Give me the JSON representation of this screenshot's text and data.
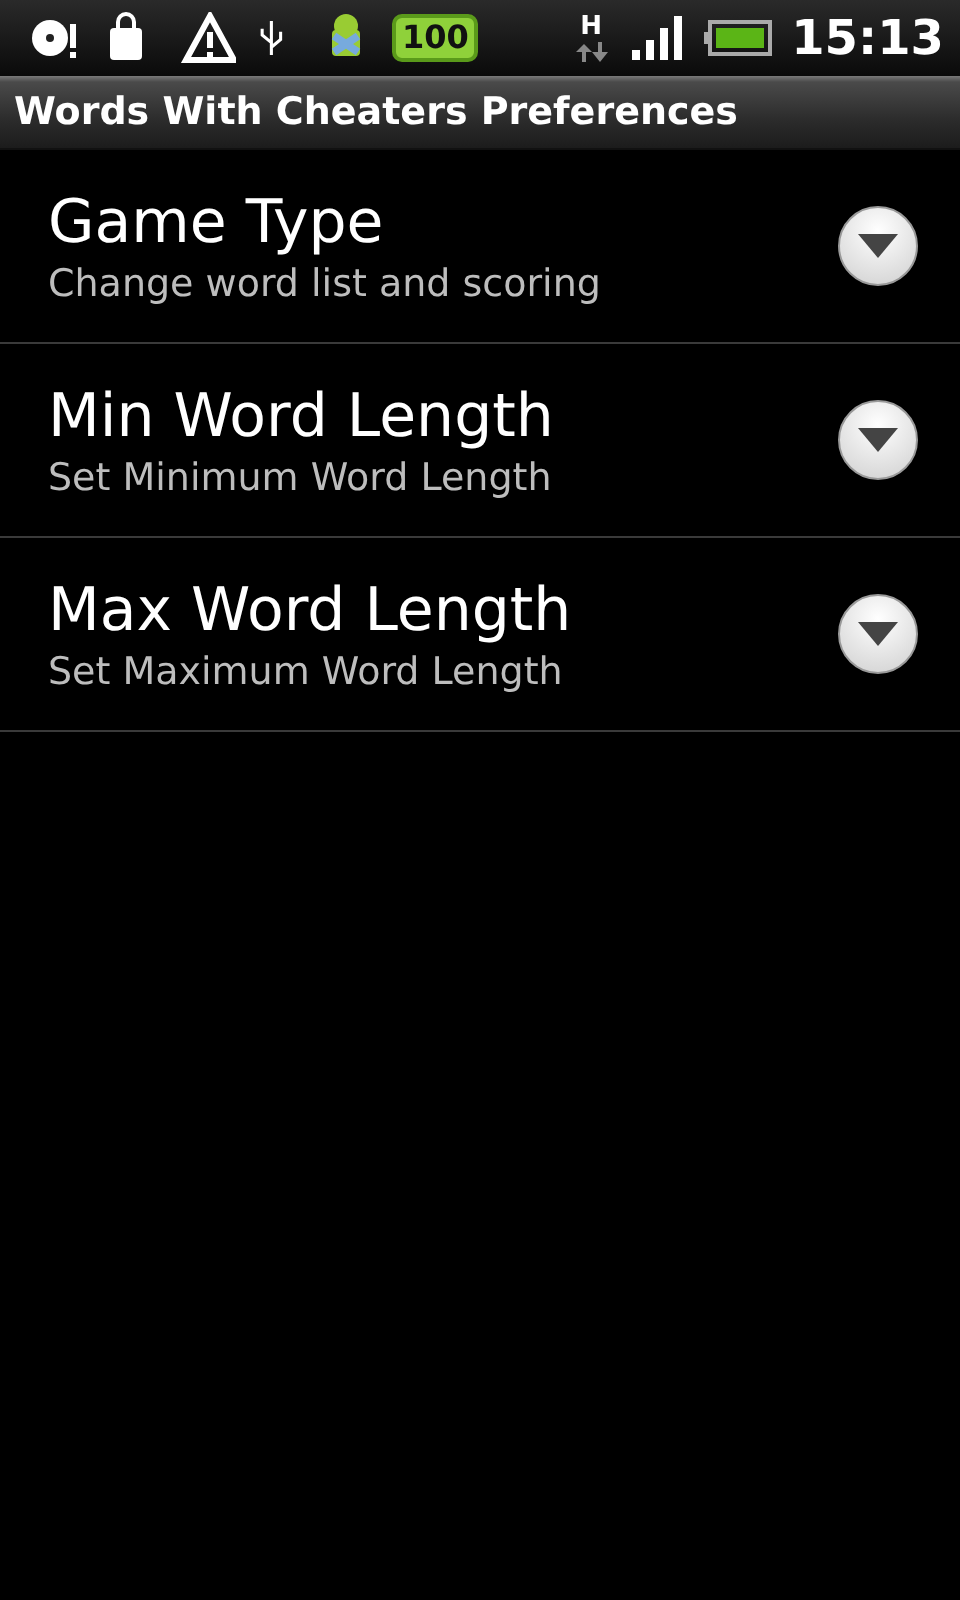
{
  "status_bar": {
    "notification_count": "100",
    "network_type": "H",
    "time": "15:13"
  },
  "window": {
    "title": "Words With Cheaters Preferences"
  },
  "preferences": [
    {
      "title": "Game Type",
      "summary": "Change word list and scoring"
    },
    {
      "title": "Min Word Length",
      "summary": "Set Minimum Word Length"
    },
    {
      "title": "Max Word Length",
      "summary": "Set Maximum Word Length"
    }
  ]
}
